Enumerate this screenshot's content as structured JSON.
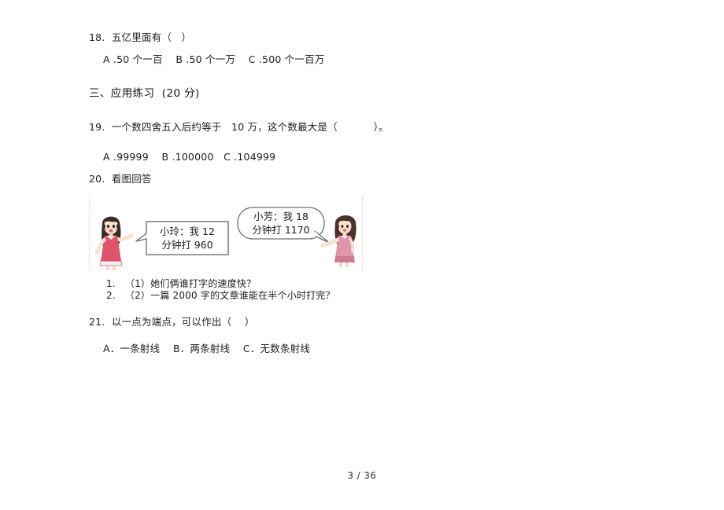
{
  "document": {
    "page_footer": "3 / 36"
  },
  "questions": [
    {
      "id": "q18",
      "number": "18.",
      "stem": "18.  五亿里面有（   ）",
      "options": "A .50 个一百    B .50 个一万    C .500 个一百万"
    },
    {
      "id": "q19",
      "number": "19.",
      "stem": "19.  一个数四舍五入后约等于   10 万，这个数最大是（           ）。",
      "options": "A .99999    B .100000   C .104999"
    },
    {
      "id": "q21",
      "number": "21.",
      "stem": "21.  以一点为端点，可以作出（    ）",
      "options": "A．一条射线    B．两条射线    C．无数条射线"
    }
  ],
  "section": {
    "heading": "三、应用练习  (20 分)"
  },
  "q20": {
    "stem": "20.  看图回答",
    "figure": {
      "left_bubble": {
        "line1": "小玲：我 12",
        "line2": "分钟打  960"
      },
      "right_bubble": {
        "line1": "小芳：我 18",
        "line2": "分钟打  1170"
      },
      "left_character": "girl-in-red-dress",
      "right_character": "girl-in-pink-top"
    },
    "sub_questions": [
      "1.   （1）她们俩谁打字的速度快？",
      "2.   （2）一篇 2000 字的文章谁能在半个小时打完？"
    ]
  },
  "colors": {
    "text": "#1c1c1c",
    "bubble_outline": "#6f6f6f",
    "figure_border": "#cfcfcf",
    "dress_red": "#e0536b",
    "top_pink": "#e394ad",
    "hair_dark": "#3a2a26",
    "skin": "#f7ddc8"
  }
}
